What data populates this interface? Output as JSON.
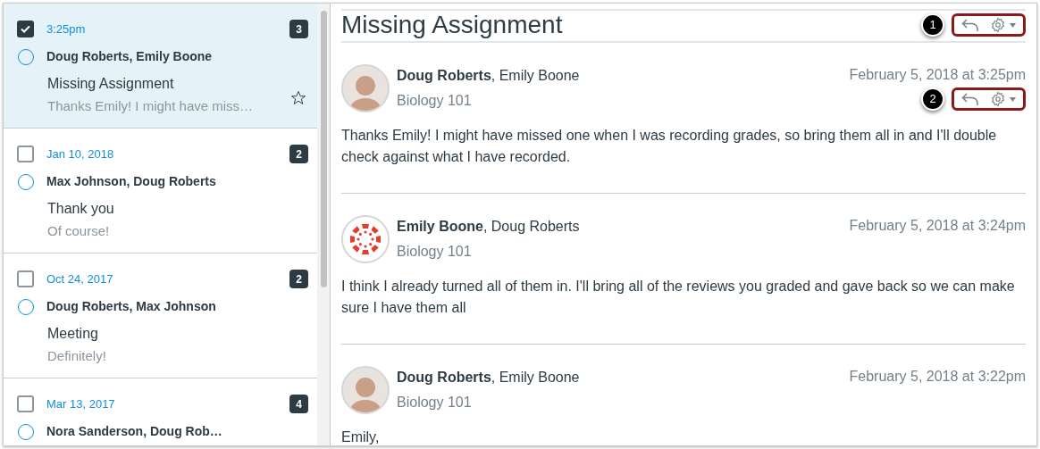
{
  "conversations": [
    {
      "date": "3:25pm",
      "participants": "Doug Roberts, Emily Boone",
      "subject": "Missing Assignment",
      "preview": "Thanks Emily! I might have miss…",
      "count": "3",
      "checked": true,
      "selected": true
    },
    {
      "date": "Jan 10, 2018",
      "participants": "Max Johnson, Doug Roberts",
      "subject": "Thank you",
      "preview": "Of course!",
      "count": "2",
      "checked": false,
      "selected": false
    },
    {
      "date": "Oct 24, 2017",
      "participants": "Doug Roberts, Max Johnson",
      "subject": "Meeting",
      "preview": "Definitely!",
      "count": "2",
      "checked": false,
      "selected": false
    },
    {
      "date": "Mar 13, 2017",
      "participants": "Nora Sanderson, Doug Rob…",
      "count": "4",
      "checked": false,
      "selected": false
    }
  ],
  "conversation_header": {
    "title": "Missing Assignment",
    "callout": "1"
  },
  "messages": [
    {
      "kind": "photo",
      "author": "Doug Roberts",
      "recipients": ", Emily Boone",
      "course": "Biology 101",
      "date": "February 5, 2018 at 3:25pm",
      "callout": "2",
      "body": "Thanks Emily! I might have missed one when I was recording grades, so bring them all in and I'll double check against what I have recorded."
    },
    {
      "kind": "logo",
      "author": "Emily Boone",
      "recipients": ", Doug Roberts",
      "course": "Biology 101",
      "date": "February 5, 2018 at 3:24pm",
      "body": "I think I already turned all of them in. I'll bring all of the reviews you graded and gave back so we can make sure I have them all"
    },
    {
      "kind": "photo",
      "author": "Doug Roberts",
      "recipients": ", Emily Boone",
      "course": "Biology 101",
      "date": "February 5, 2018 at 3:22pm",
      "body": "Emily,"
    }
  ]
}
